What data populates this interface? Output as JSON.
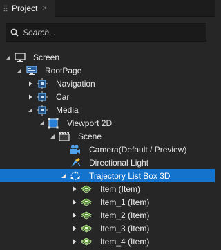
{
  "panel": {
    "tab_label": "Project",
    "close_glyph": "×"
  },
  "search": {
    "placeholder": "Search..."
  },
  "tree": [
    {
      "id": "screen",
      "label": "Screen",
      "icon": "monitor-icon",
      "expanded": true
    },
    {
      "id": "rootpage",
      "label": "RootPage",
      "icon": "page-icon",
      "expanded": true
    },
    {
      "id": "navigation",
      "label": "Navigation",
      "icon": "node-icon",
      "expanded": false
    },
    {
      "id": "car",
      "label": "Car",
      "icon": "node-icon",
      "expanded": false
    },
    {
      "id": "media",
      "label": "Media",
      "icon": "node-icon",
      "expanded": true
    },
    {
      "id": "viewport2d",
      "label": "Viewport 2D",
      "icon": "viewport-icon",
      "expanded": true
    },
    {
      "id": "scene",
      "label": "Scene",
      "icon": "scene-icon",
      "expanded": true
    },
    {
      "id": "camera",
      "label": "Camera",
      "label_suffix": "(Default / Preview)",
      "icon": "camera-icon"
    },
    {
      "id": "light",
      "label": "Directional Light",
      "icon": "light-icon"
    },
    {
      "id": "trajectory",
      "label": "Trajectory List Box 3D",
      "icon": "trajectory-icon",
      "expanded": true,
      "selected": true
    },
    {
      "id": "item0",
      "label": "Item (Item)",
      "icon": "item-icon",
      "expanded": false
    },
    {
      "id": "item1",
      "label": "Item_1 (Item)",
      "icon": "item-icon",
      "expanded": false
    },
    {
      "id": "item2",
      "label": "Item_2 (Item)",
      "icon": "item-icon",
      "expanded": false
    },
    {
      "id": "item3",
      "label": "Item_3 (Item)",
      "icon": "item-icon",
      "expanded": false
    },
    {
      "id": "item4",
      "label": "Item_4 (Item)",
      "icon": "item-icon",
      "expanded": false
    }
  ],
  "colors": {
    "selection": "#1473cc",
    "node_icon": "#5aa8e8",
    "item_icon": "#8bd36a"
  }
}
